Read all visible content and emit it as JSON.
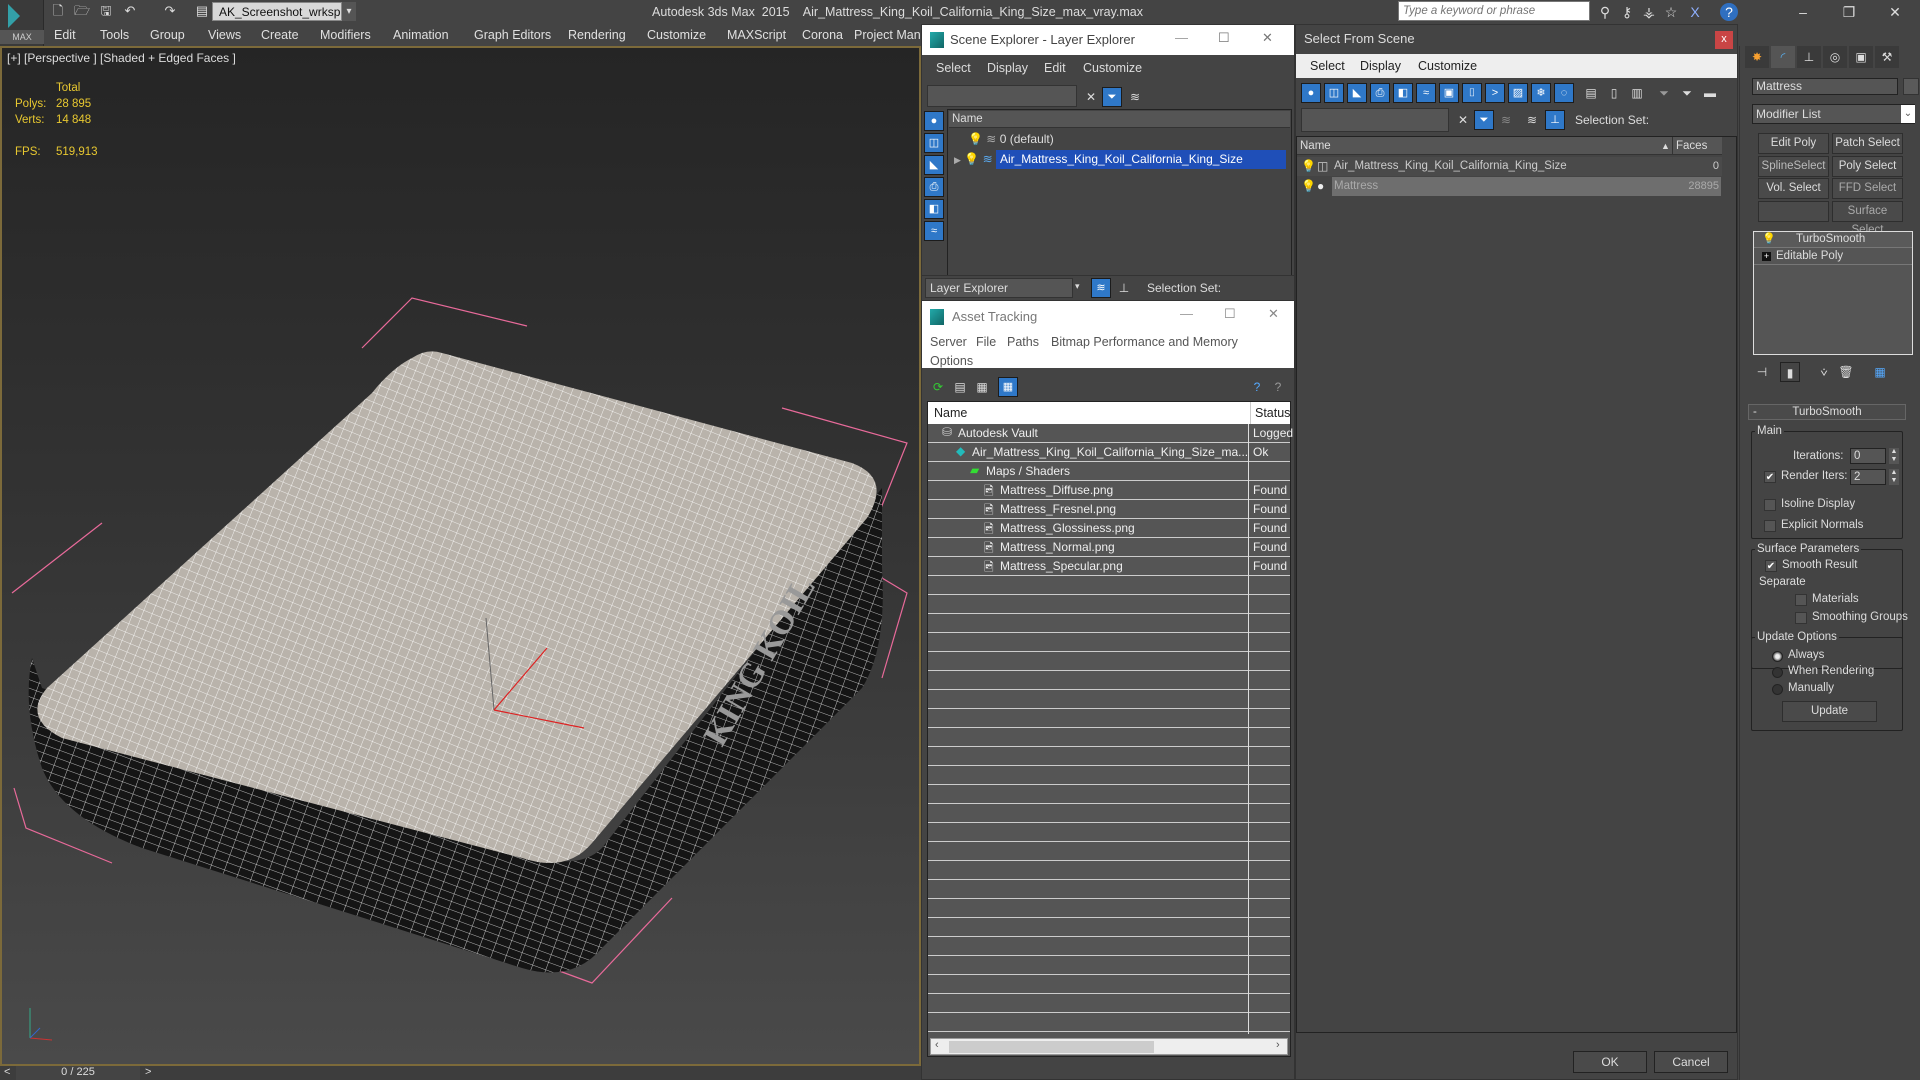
{
  "app": {
    "title": "Autodesk 3ds Max  2015    Air_Mattress_King_Koil_California_King_Size_max_vray.max",
    "logo_label": "MAX",
    "workspace": "AK_Screenshot_wrksp",
    "search_placeholder": "Type a keyword or phrase"
  },
  "menu": [
    "Edit",
    "Tools",
    "Group",
    "Views",
    "Create",
    "Modifiers",
    "Animation",
    "Graph Editors",
    "Rendering",
    "Customize",
    "MAXScript",
    "Corona",
    "Project Mana"
  ],
  "viewport": {
    "label": "[+] [Perspective ] [Shaded + Edged Faces ]",
    "stats": {
      "total_label": "Total",
      "polys_label": "Polys:",
      "polys_value": "28 895",
      "verts_label": "Verts:",
      "verts_value": "14 848",
      "fps_label": "FPS:",
      "fps_value": "519,913"
    },
    "logo_text_on_mattress": "KING KOIL"
  },
  "timeslider": {
    "prev": "<",
    "frame": "0 / 225",
    "next": ">"
  },
  "scene_explorer": {
    "title": "Scene Explorer - Layer Explorer",
    "menu": [
      "Select",
      "Display",
      "Edit",
      "Customize"
    ],
    "column_name": "Name",
    "rows": [
      {
        "label": "0 (default)",
        "selected": false
      },
      {
        "label": "Air_Mattress_King_Koil_California_King_Size",
        "selected": true
      }
    ],
    "explorer_dropdown": "Layer Explorer",
    "selection_set_label": "Selection Set:"
  },
  "asset_tracking": {
    "title": "Asset Tracking",
    "menu": [
      "Server",
      "File",
      "Paths",
      "Bitmap Performance and Memory",
      "Options"
    ],
    "columns": [
      "Name",
      "Status"
    ],
    "rows": [
      {
        "name": "Autodesk Vault",
        "status": "Logged",
        "indent": 0,
        "icon": "vault-icon"
      },
      {
        "name": "Air_Mattress_King_Koil_California_King_Size_ma...",
        "status": "Ok",
        "indent": 1,
        "icon": "max-file-icon"
      },
      {
        "name": "Maps / Shaders",
        "status": "",
        "indent": 2,
        "icon": "maps-icon"
      },
      {
        "name": "Mattress_Diffuse.png",
        "status": "Found",
        "indent": 3,
        "icon": "image-file-icon"
      },
      {
        "name": "Mattress_Fresnel.png",
        "status": "Found",
        "indent": 3,
        "icon": "image-file-icon"
      },
      {
        "name": "Mattress_Glossiness.png",
        "status": "Found",
        "indent": 3,
        "icon": "image-file-icon"
      },
      {
        "name": "Mattress_Normal.png",
        "status": "Found",
        "indent": 3,
        "icon": "image-file-icon"
      },
      {
        "name": "Mattress_Specular.png",
        "status": "Found",
        "indent": 3,
        "icon": "image-file-icon"
      }
    ]
  },
  "select_from_scene": {
    "title": "Select From Scene",
    "close": "x",
    "menu": [
      "Select",
      "Display",
      "Customize"
    ],
    "selection_set_label": "Selection Set:",
    "columns": [
      "Name",
      "Faces"
    ],
    "rows": [
      {
        "name": "Air_Mattress_King_Koil_California_King_Size",
        "faces": "0",
        "selected": false
      },
      {
        "name": "Mattress",
        "faces": "28895",
        "selected": true
      }
    ],
    "ok": "OK",
    "cancel": "Cancel"
  },
  "command_panel": {
    "object_name": "Mattress",
    "modifier_list": "Modifier List",
    "modifier_buttons": [
      "Edit Poly",
      "Patch Select",
      "SplineSelect",
      "Poly Select",
      "Vol. Select",
      "FFD Select",
      "",
      "Surface Select"
    ],
    "stack": [
      "TurboSmooth",
      "Editable Poly"
    ],
    "rollout_title": "TurboSmooth",
    "main_group": "Main",
    "iterations_label": "Iterations:",
    "iterations_value": "0",
    "render_iters_label": "Render Iters:",
    "render_iters_value": "2",
    "render_iters_checked": true,
    "isoline_label": "Isoline Display",
    "isoline_checked": false,
    "explicit_normals_label": "Explicit Normals",
    "explicit_normals_checked": false,
    "surface_group": "Surface Parameters",
    "smooth_result_label": "Smooth Result",
    "smooth_result_checked": true,
    "separate_label": "Separate",
    "materials_label": "Materials",
    "smoothing_groups_label": "Smoothing Groups",
    "update_group": "Update Options",
    "update_options": [
      "Always",
      "When Rendering",
      "Manually"
    ],
    "update_selected": "Always",
    "update_button": "Update"
  }
}
